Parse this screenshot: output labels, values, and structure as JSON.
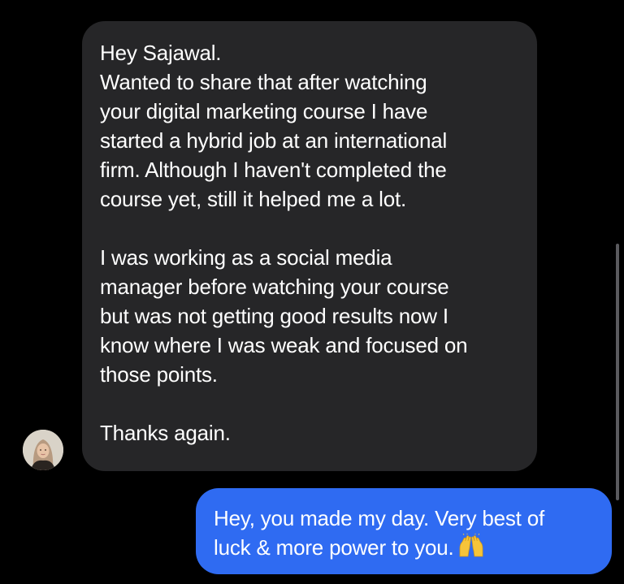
{
  "conversation": {
    "received_message": {
      "paragraph_1": "Hey Sajawal.\nWanted to share that after watching\nyour digital marketing course I have\nstarted a hybrid job at an international\nfirm. Although I haven't completed the\ncourse yet, still it helped me a lot.",
      "paragraph_2": "I was working as a social media\nmanager before watching your course\nbut was not getting good results now I\nknow where I was weak and focused on\nthose points.",
      "paragraph_3": "Thanks again."
    },
    "sent_message": {
      "line_1": "Hey, you made my day. Very best of",
      "line_2": "luck & more power to you.",
      "emoji": "raising-hands-icon"
    }
  },
  "colors": {
    "background": "#000000",
    "received_bubble": "#262628",
    "sent_bubble": "#2f6bf2",
    "text": "#ffffff"
  }
}
